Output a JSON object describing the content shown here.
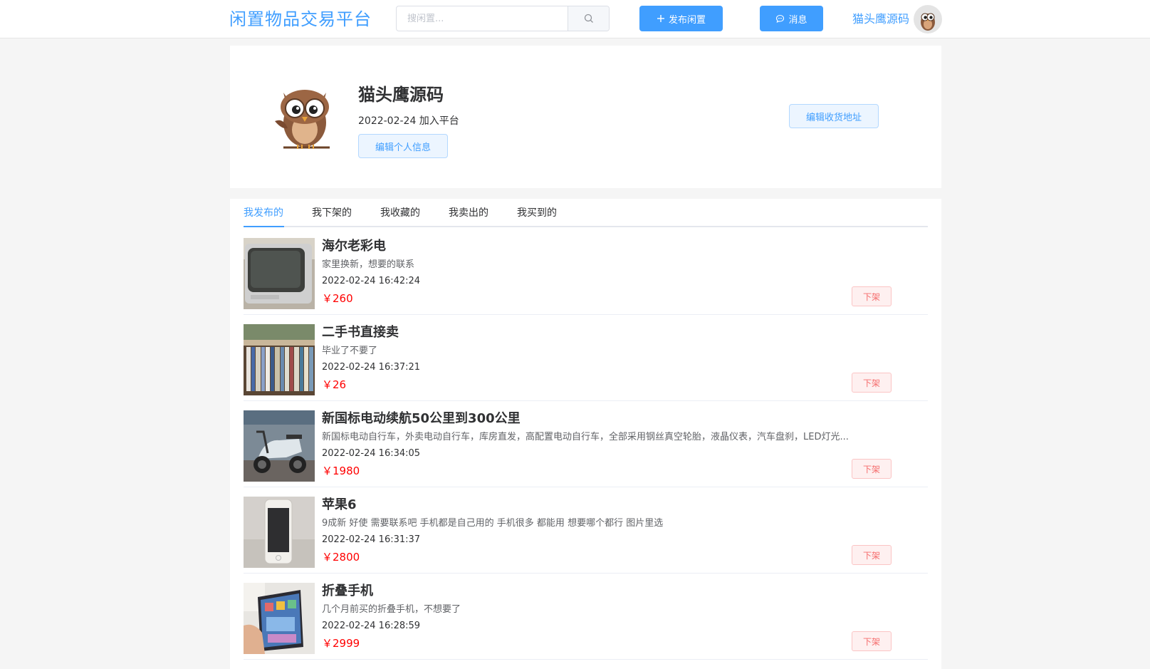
{
  "header": {
    "title": "闲置物品交易平台",
    "search_placeholder": "搜闲置...",
    "publish_label": "发布闲置",
    "message_label": "消息",
    "username": "猫头鹰源码"
  },
  "profile": {
    "name": "猫头鹰源码",
    "join_date": "2022-02-24 加入平台",
    "edit_info_label": "编辑个人信息",
    "edit_address_label": "编辑收货地址"
  },
  "tabs": [
    {
      "label": "我发布的",
      "active": true
    },
    {
      "label": "我下架的",
      "active": false
    },
    {
      "label": "我收藏的",
      "active": false
    },
    {
      "label": "我卖出的",
      "active": false
    },
    {
      "label": "我买到的",
      "active": false
    }
  ],
  "items": [
    {
      "title": "海尔老彩电",
      "desc": "家里换新，想要的联系",
      "time": "2022-02-24 16:42:24",
      "price": "￥260",
      "action": "下架",
      "thumb": "tv-thumbnail"
    },
    {
      "title": "二手书直接卖",
      "desc": "毕业了不要了",
      "time": "2022-02-24 16:37:21",
      "price": "￥26",
      "action": "下架",
      "thumb": "books-thumbnail"
    },
    {
      "title": "新国标电动续航50公里到300公里",
      "desc": "新国标电动自行车，外卖电动自行车，库房直发，高配置电动自行车，全部采用钢丝真空轮胎，液晶仪表，汽车盘刹，LED灯光...",
      "time": "2022-02-24 16:34:05",
      "price": "￥1980",
      "action": "下架",
      "thumb": "ebike-thumbnail"
    },
    {
      "title": "苹果6",
      "desc": "9成新 好使 需要联系吧 手机都是自己用的 手机很多 都能用 想要哪个都行 图片里选",
      "time": "2022-02-24 16:31:37",
      "price": "￥2800",
      "action": "下架",
      "thumb": "phone-thumbnail"
    },
    {
      "title": "折叠手机",
      "desc": "几个月前买的折叠手机，不想要了",
      "time": "2022-02-24 16:28:59",
      "price": "￥2999",
      "action": "下架",
      "thumb": "fold-phone-thumbnail"
    }
  ],
  "colors": {
    "accent": "#409eff",
    "price": "#ff0000",
    "danger": "#f56c6c"
  }
}
